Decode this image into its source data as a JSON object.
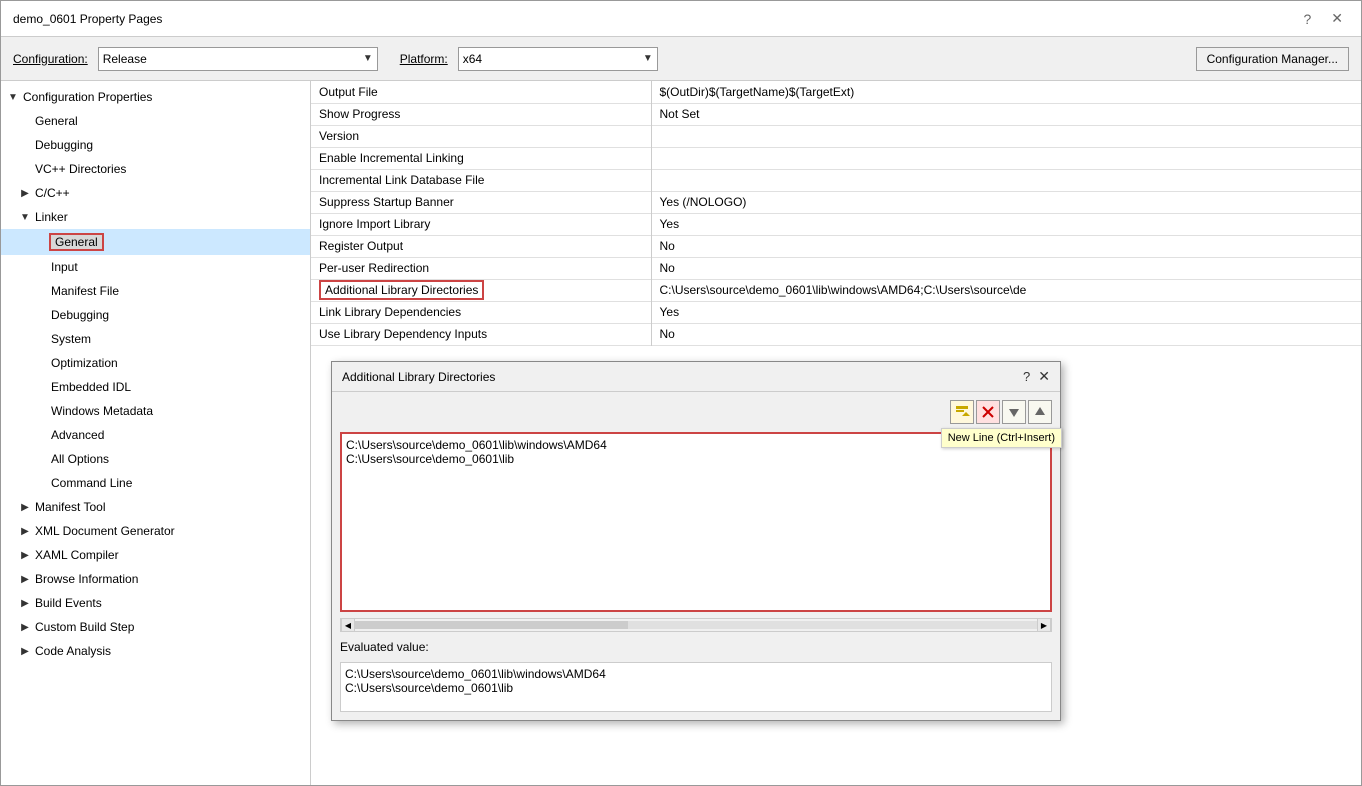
{
  "window": {
    "title": "demo_0601 Property Pages",
    "question_icon": "?",
    "close_icon": "✕"
  },
  "config_bar": {
    "config_label": "Configuration:",
    "config_value": "Release",
    "config_arrow": "▼",
    "platform_label": "Platform:",
    "platform_value": "x64",
    "platform_arrow": "▼",
    "manager_btn": "Configuration Manager..."
  },
  "sidebar": {
    "items": [
      {
        "id": "config-props",
        "label": "Configuration Properties",
        "indent": 0,
        "expand": "▼"
      },
      {
        "id": "general",
        "label": "General",
        "indent": 1,
        "expand": ""
      },
      {
        "id": "debugging",
        "label": "Debugging",
        "indent": 1,
        "expand": ""
      },
      {
        "id": "vc-dirs",
        "label": "VC++ Directories",
        "indent": 1,
        "expand": ""
      },
      {
        "id": "cpp",
        "label": "C/C++",
        "indent": 1,
        "expand": "▶"
      },
      {
        "id": "linker",
        "label": "Linker",
        "indent": 1,
        "expand": "▼"
      },
      {
        "id": "linker-general",
        "label": "General",
        "indent": 2,
        "expand": "",
        "selected": true
      },
      {
        "id": "input",
        "label": "Input",
        "indent": 2,
        "expand": ""
      },
      {
        "id": "manifest-file",
        "label": "Manifest File",
        "indent": 2,
        "expand": ""
      },
      {
        "id": "linker-debugging",
        "label": "Debugging",
        "indent": 2,
        "expand": ""
      },
      {
        "id": "system",
        "label": "System",
        "indent": 2,
        "expand": ""
      },
      {
        "id": "optimization",
        "label": "Optimization",
        "indent": 2,
        "expand": ""
      },
      {
        "id": "embedded-idl",
        "label": "Embedded IDL",
        "indent": 2,
        "expand": ""
      },
      {
        "id": "windows-metadata",
        "label": "Windows Metadata",
        "indent": 2,
        "expand": ""
      },
      {
        "id": "advanced",
        "label": "Advanced",
        "indent": 2,
        "expand": ""
      },
      {
        "id": "all-options",
        "label": "All Options",
        "indent": 2,
        "expand": ""
      },
      {
        "id": "command-line",
        "label": "Command Line",
        "indent": 2,
        "expand": ""
      },
      {
        "id": "manifest-tool",
        "label": "Manifest Tool",
        "indent": 1,
        "expand": "▶"
      },
      {
        "id": "xml-doc-gen",
        "label": "XML Document Generator",
        "indent": 1,
        "expand": "▶"
      },
      {
        "id": "xaml-compiler",
        "label": "XAML Compiler",
        "indent": 1,
        "expand": "▶"
      },
      {
        "id": "browse-info",
        "label": "Browse Information",
        "indent": 1,
        "expand": "▶"
      },
      {
        "id": "build-events",
        "label": "Build Events",
        "indent": 1,
        "expand": "▶"
      },
      {
        "id": "custom-build-step",
        "label": "Custom Build Step",
        "indent": 1,
        "expand": "▶"
      },
      {
        "id": "code-analysis",
        "label": "Code Analysis",
        "indent": 1,
        "expand": "▶"
      }
    ]
  },
  "props": {
    "rows": [
      {
        "name": "Output File",
        "value": "$(OutDir)$(TargetName)$(TargetExt)",
        "highlighted": false
      },
      {
        "name": "Show Progress",
        "value": "Not Set",
        "highlighted": false
      },
      {
        "name": "Version",
        "value": "",
        "highlighted": false
      },
      {
        "name": "Enable Incremental Linking",
        "value": "",
        "highlighted": false
      },
      {
        "name": "Incremental Link Database File",
        "value": "",
        "highlighted": false
      },
      {
        "name": "Suppress Startup Banner",
        "value": "Yes (/NOLOGO)",
        "highlighted": false
      },
      {
        "name": "Ignore Import Library",
        "value": "Yes",
        "highlighted": false
      },
      {
        "name": "Register Output",
        "value": "No",
        "highlighted": false
      },
      {
        "name": "Per-user Redirection",
        "value": "No",
        "highlighted": false
      },
      {
        "name": "Additional Library Directories",
        "value": "C:\\Users\\source\\demo_0601\\lib\\windows\\AMD64;C:\\Users\\source\\de",
        "highlighted": true
      },
      {
        "name": "Link Library Dependencies",
        "value": "Yes",
        "highlighted": false
      },
      {
        "name": "Use Library Dependency Inputs",
        "value": "No",
        "highlighted": false
      }
    ]
  },
  "dialog": {
    "title": "Additional Library Directories",
    "question": "?",
    "close": "✕",
    "toolbar": {
      "new_line_icon": "★",
      "delete_icon": "✕",
      "move_down_icon": "↓",
      "move_up_icon": "↑",
      "tooltip": "New Line (Ctrl+Insert)"
    },
    "lines": [
      "C:\\Users\\source\\demo_0601\\lib\\windows\\AMD64",
      "C:\\Users\\source\\demo_0601\\lib"
    ],
    "evaluated_label": "Evaluated value:",
    "evaluated_lines": [
      "C:\\Users\\source\\demo_0601\\lib\\windows\\AMD64",
      "C:\\Users\\source\\demo_0601\\lib"
    ]
  }
}
